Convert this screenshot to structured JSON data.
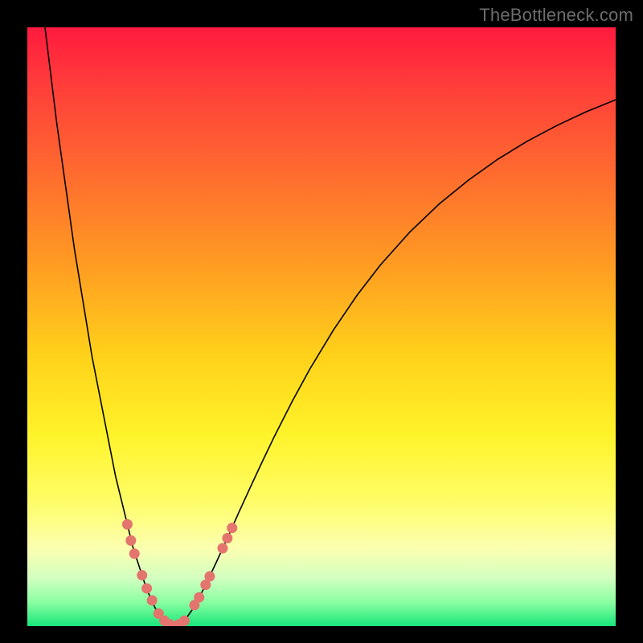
{
  "watermark": "TheBottleneck.com",
  "colors": {
    "frame": "#000000",
    "curve_stroke": "#000000",
    "marker_fill": "#e3746e",
    "marker_stroke": "#e3746e"
  },
  "chart_data": {
    "type": "line",
    "title": "",
    "xlabel": "",
    "ylabel": "",
    "xlim": [
      0,
      100
    ],
    "ylim": [
      0,
      100
    ],
    "grid": false,
    "legend": false,
    "series": [
      {
        "name": "bottleneck-curve",
        "x": [
          3,
          4,
          5,
          6,
          7,
          8,
          9,
          10,
          11,
          12,
          13,
          14,
          15,
          16,
          17,
          18,
          19,
          20,
          21,
          22,
          23,
          24,
          25,
          26,
          27,
          28,
          29,
          30,
          32,
          34,
          36,
          38,
          40,
          42,
          45,
          48,
          52,
          56,
          60,
          65,
          70,
          75,
          80,
          85,
          90,
          95,
          100
        ],
        "y": [
          100,
          92,
          84,
          77,
          70,
          63,
          57,
          51,
          45,
          40,
          35,
          30,
          25,
          21,
          17,
          13,
          10,
          7,
          4.5,
          2.5,
          1.2,
          0.4,
          0,
          0.4,
          1.3,
          2.7,
          4.4,
          6.3,
          10.4,
          14.7,
          19.1,
          23.4,
          27.6,
          31.7,
          37.5,
          42.9,
          49.4,
          55.2,
          60.3,
          65.8,
          70.5,
          74.5,
          78,
          81,
          83.6,
          85.9,
          87.9
        ]
      }
    ],
    "markers": [
      {
        "x": 17.0,
        "y": 17.0
      },
      {
        "x": 17.6,
        "y": 14.3
      },
      {
        "x": 18.2,
        "y": 12.1
      },
      {
        "x": 19.5,
        "y": 8.5
      },
      {
        "x": 20.3,
        "y": 6.3
      },
      {
        "x": 21.2,
        "y": 4.3
      },
      {
        "x": 22.3,
        "y": 2.1
      },
      {
        "x": 23.3,
        "y": 0.9
      },
      {
        "x": 24.2,
        "y": 0.3
      },
      {
        "x": 25.0,
        "y": 0.0
      },
      {
        "x": 25.8,
        "y": 0.3
      },
      {
        "x": 26.7,
        "y": 0.9
      },
      {
        "x": 28.4,
        "y": 3.5
      },
      {
        "x": 29.2,
        "y": 4.8
      },
      {
        "x": 30.3,
        "y": 6.9
      },
      {
        "x": 31.0,
        "y": 8.3
      },
      {
        "x": 33.2,
        "y": 13.0
      },
      {
        "x": 34.0,
        "y": 14.7
      },
      {
        "x": 34.8,
        "y": 16.4
      }
    ]
  }
}
